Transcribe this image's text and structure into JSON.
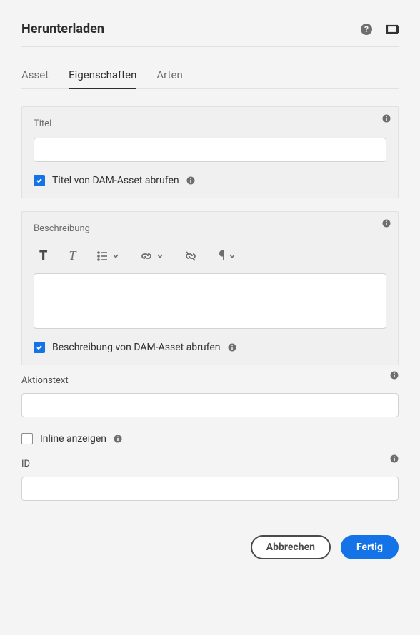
{
  "header": {
    "title": "Herunterladen"
  },
  "tabs": [
    {
      "label": "Asset",
      "active": false
    },
    {
      "label": "Eigenschaften",
      "active": true
    },
    {
      "label": "Arten",
      "active": false
    }
  ],
  "titlePanel": {
    "label": "Titel",
    "value": "",
    "checkbox": {
      "label": "Titel von DAM-Asset abrufen",
      "checked": true
    }
  },
  "descriptionPanel": {
    "label": "Beschreibung",
    "value": "",
    "checkbox": {
      "label": "Beschreibung von DAM-Asset abrufen",
      "checked": true
    }
  },
  "actionText": {
    "label": "Aktionstext",
    "value": ""
  },
  "inlineCheckbox": {
    "label": "Inline anzeigen",
    "checked": false
  },
  "idField": {
    "label": "ID",
    "value": ""
  },
  "footer": {
    "cancel": "Abbrechen",
    "done": "Fertig"
  }
}
